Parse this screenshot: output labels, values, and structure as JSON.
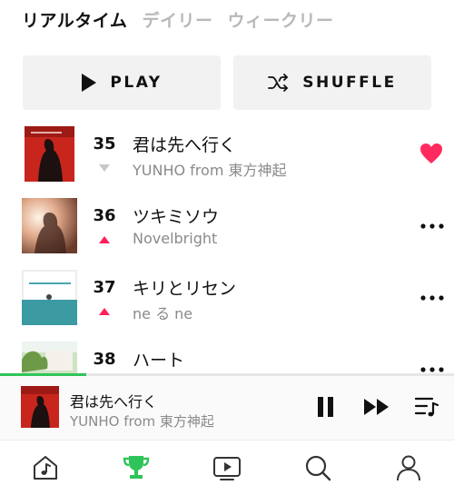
{
  "tabs": [
    {
      "label": "リアルタイム",
      "active": true
    },
    {
      "label": "デイリー",
      "active": false
    },
    {
      "label": "ウィークリー",
      "active": false
    }
  ],
  "actions": {
    "play_label": "PLAY",
    "play_icon": "play-icon",
    "shuffle_label": "SHUFFLE",
    "shuffle_icon": "shuffle-icon"
  },
  "tracks": [
    {
      "rank": "35",
      "title": "君は先へ行く",
      "artist": "YUNHO from 東方神起",
      "trend": "down",
      "liked": true
    },
    {
      "rank": "36",
      "title": "ツキミソウ",
      "artist": "Novelbright",
      "trend": "up",
      "liked": false
    },
    {
      "rank": "37",
      "title": "キリとリセン",
      "artist": "ne る ne",
      "trend": "up",
      "liked": false
    },
    {
      "rank": "38",
      "title": "ハート",
      "artist": "",
      "trend": "",
      "liked": false
    }
  ],
  "now_playing": {
    "title": "君は先へ行く",
    "artist": "YUNHO from 東方神起",
    "progress": 0.19
  },
  "nav": [
    {
      "name": "home",
      "icon": "music-home-icon",
      "active": false
    },
    {
      "name": "chart",
      "icon": "trophy-icon",
      "active": true
    },
    {
      "name": "video",
      "icon": "video-play-icon",
      "active": false
    },
    {
      "name": "search",
      "icon": "search-icon",
      "active": false
    },
    {
      "name": "profile",
      "icon": "person-icon",
      "active": false
    }
  ],
  "colors": {
    "accent_green": "#2fc45a",
    "trend_up": "#ff1f5a",
    "trend_down": "#c8c8c8",
    "heart": "#ff2b5e"
  }
}
